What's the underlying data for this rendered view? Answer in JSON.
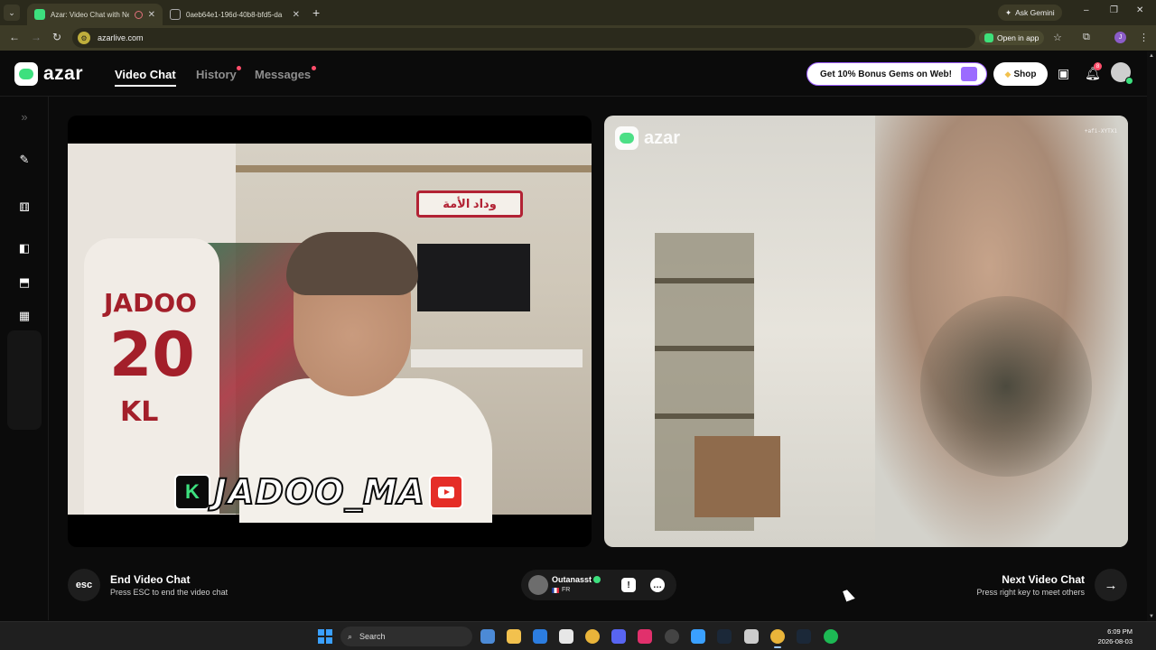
{
  "browser": {
    "tabs": [
      {
        "title": "Azar: Video Chat with New",
        "active": true
      },
      {
        "title": "0aeb64e1-196d-40b8-bfd5-da",
        "active": false
      }
    ],
    "new_tab": "+",
    "ask_gemini": "Ask Gemini",
    "url": "azarlive.com",
    "open_in_app": "Open in app",
    "profile_initial": "J",
    "window_controls": [
      "–",
      "❐",
      "✕"
    ]
  },
  "header": {
    "logo_text": "azar",
    "nav": [
      {
        "label": "Video Chat",
        "active": true,
        "dot": false
      },
      {
        "label": "History",
        "active": false,
        "dot": true
      },
      {
        "label": "Messages",
        "active": false,
        "dot": true
      }
    ],
    "promo": "Get 10% Bonus Gems on Web!",
    "shop": "Shop",
    "shop_icon": "◆",
    "notification_count": "8"
  },
  "local_video": {
    "jersey_name": "JADOO",
    "jersey_number": "20",
    "jersey_letters": "KL",
    "banner": "وداد الأمة",
    "overlay_badge": "K",
    "overlay_name": "JADOO_MA"
  },
  "remote_video": {
    "watermark_text": "azar",
    "watermark_id": "+afi-XYTX1"
  },
  "controls": {
    "esc_label": "esc",
    "end_title": "End Video Chat",
    "end_sub": "Press ESC to end the video chat",
    "peer_name": "Outanasst",
    "peer_country": "FR",
    "report_icon": "!",
    "chat_icon": "…",
    "next_title": "Next Video Chat",
    "next_sub": "Press right key to meet others",
    "next_icon": "→"
  },
  "taskbar": {
    "search_placeholder": "Search",
    "time": "6:09 PM",
    "date": "2026-08-03",
    "icons": [
      {
        "name": "widgets-icon",
        "color": "#4c8ad6"
      },
      {
        "name": "file-explorer-icon",
        "color": "#f2c14e"
      },
      {
        "name": "mail-icon",
        "color": "#2c7de0"
      },
      {
        "name": "store-icon",
        "color": "#e7e7e7"
      },
      {
        "name": "chrome-icon",
        "color": "#e9b43a"
      },
      {
        "name": "discord-icon",
        "color": "#5865f2"
      },
      {
        "name": "instagram-icon",
        "color": "#e1306c"
      },
      {
        "name": "obs-icon",
        "color": "#444444"
      },
      {
        "name": "photos-icon",
        "color": "#3aa0ff"
      },
      {
        "name": "steam-icon",
        "color": "#1b2838"
      },
      {
        "name": "capture-icon",
        "color": "#cccccc"
      },
      {
        "name": "chrome-active-icon",
        "color": "#e9b43a"
      },
      {
        "name": "steam-client-icon",
        "color": "#1b2838"
      },
      {
        "name": "spotify-icon",
        "color": "#1db954"
      }
    ]
  }
}
